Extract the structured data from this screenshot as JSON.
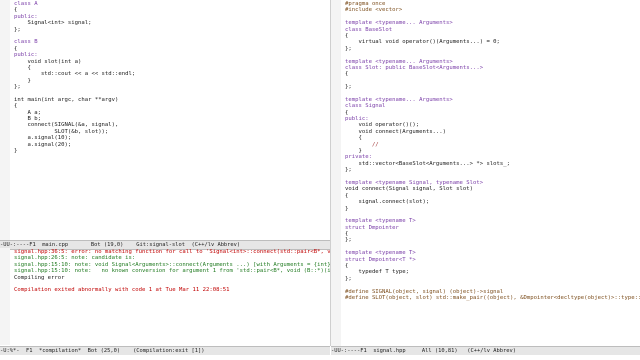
{
  "left_code": [
    "class A",
    "{",
    "public:",
    "    Signal<int> signal;",
    "};",
    "",
    "class B",
    "{",
    "public:",
    "    void slot(int a)",
    "    {",
    "        std::cout << a << std::endl;",
    "    }",
    "};",
    "",
    "int main(int argc, char **argv)",
    "{",
    "    A a;",
    "    B b;",
    "    connect(SIGNAL(&a, signal),",
    "            SLOT(&b, slot));",
    "    a.signal(10);",
    "    a.signal(20);",
    "}"
  ],
  "left_modeline": "-UU-:----F1  main.cpp       Bot (19,0)    Git:signal-slot  (C++/lv Abbrev)",
  "compilation_lines": [
    "signal.hpp:36:5: error: no matching function for call to 'Signal<int>::connect(std::pair<B*, void (B::*)(int)>)'",
    "signal.hpp:26:5: note: candidate is:",
    "signal.hpp:15:10: note: void Signal<Arguments>::connect(Arguments ...) [with Arguments = {int}]",
    "signal.hpp:15:10: note:   no known conversion for argument 1 from 'std::pair<B*, void (B::*)(int)>' to",
    "Compiling error",
    "",
    "Compilation exited abnormally with code 1 at Tue Mar 11 22:08:51"
  ],
  "bottom_modeline": "-U:%*-  F1  *compilation*  Bot (25,0)    (Compilation:exit [1])",
  "right_code": [
    "#pragma once",
    "#include <vector>",
    "",
    "template <typename... Arguments>",
    "class BaseSlot",
    "{",
    "    virtual void operator()(Arguments...) = 0;",
    "};",
    "",
    "template <typename... Arguments>",
    "class Slot: public BaseSlot<Arguments...>",
    "{",
    "",
    "};",
    "",
    "template <typename... Arguments>",
    "class Signal",
    "{",
    "public:",
    "    void operator()();",
    "    void connect(Arguments...)",
    "    {",
    "        //",
    "    }",
    "private:",
    "    std::vector<BaseSlot<Arguments...> *> slots_;",
    "};",
    "",
    "template <typename Signal, typename Slot>",
    "void connect(Signal signal, Slot slot)",
    "{",
    "    signal.connect(slot);",
    "}",
    "",
    "template <typename T>",
    "struct Dmpointer",
    "{",
    "};",
    "",
    "template <typename T>",
    "struct Dmpointer<T *>",
    "{",
    "    typedef T type;",
    "};",
    "",
    "#define SIGNAL(object, signal) (object)->signal",
    "#define SLOT(object, slot) std::make_pair((object), &Dmpointer<decltype(object)>::type::slot)"
  ],
  "right_modeline": "-UU-:----F1  signal.hpp     All (10,81)   (C++/lv Abbrev)"
}
